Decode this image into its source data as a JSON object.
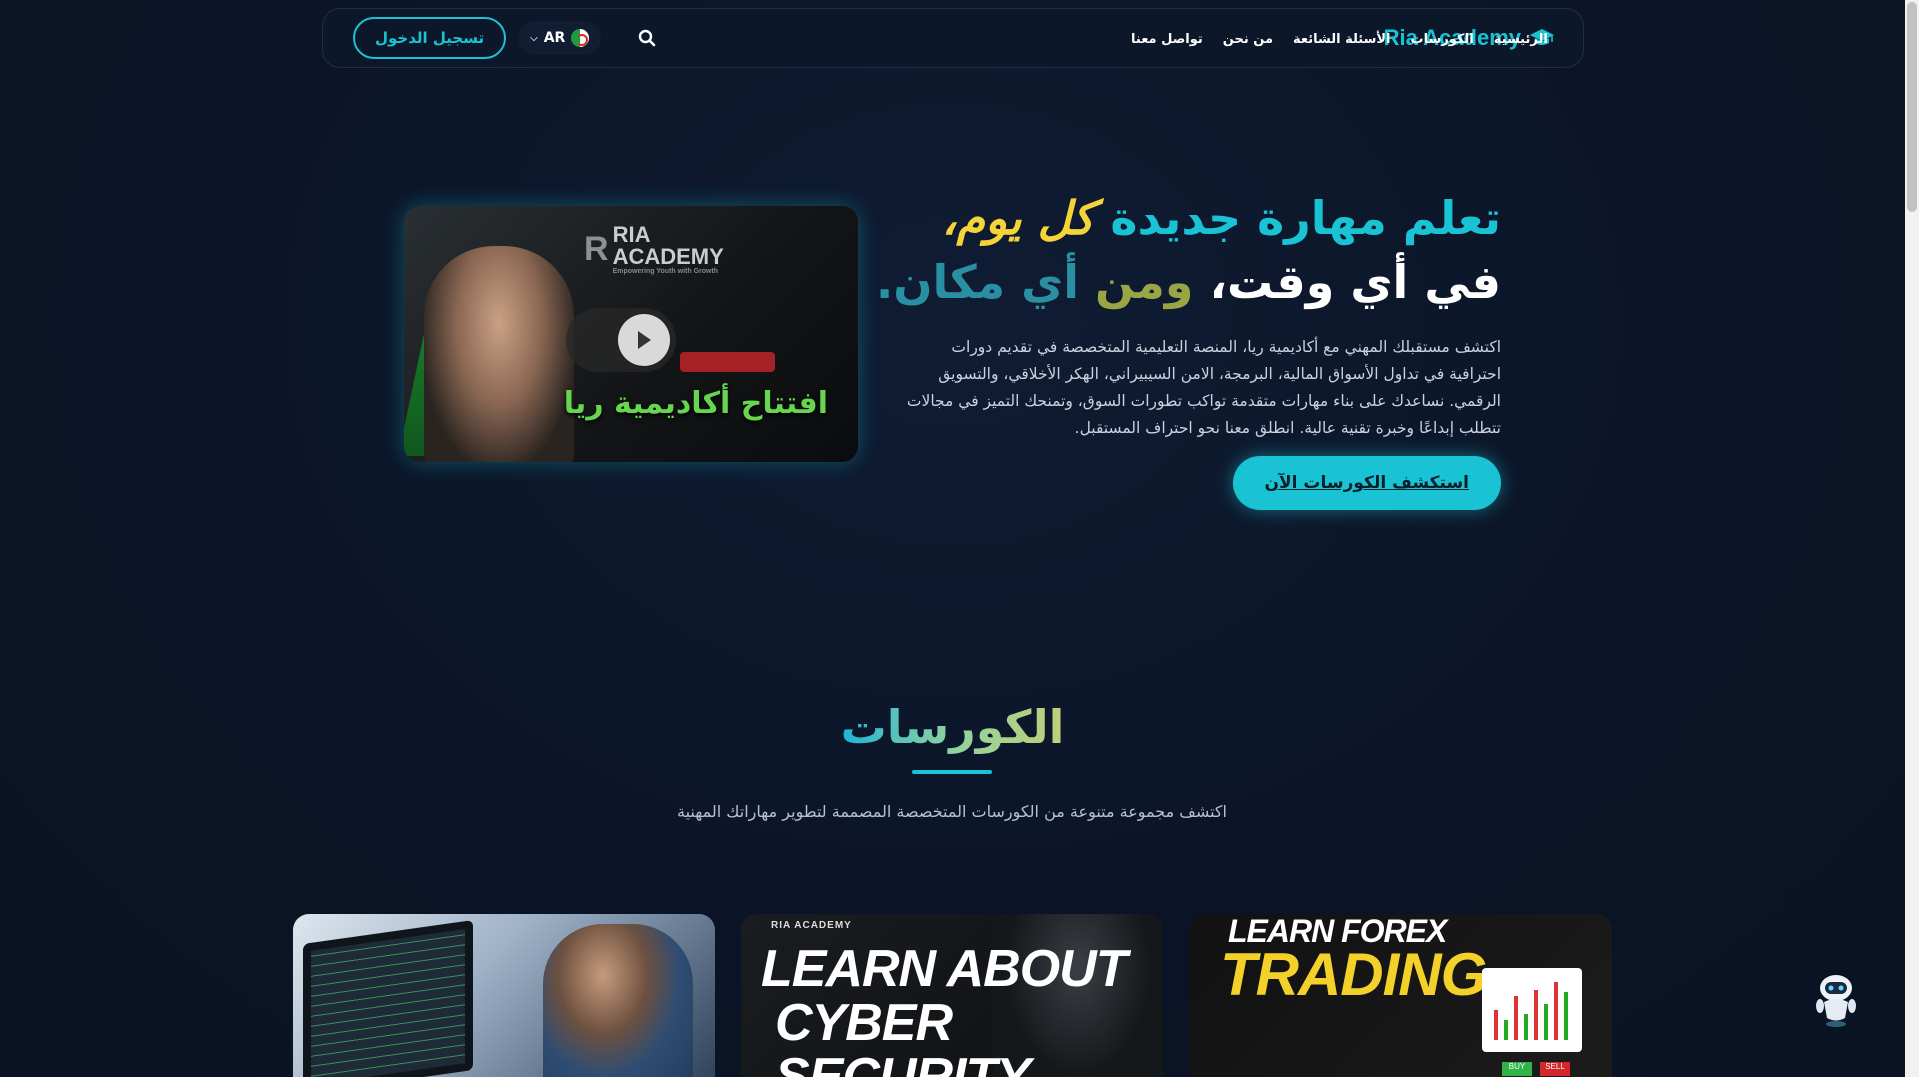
{
  "nav": {
    "login_label": "تسجيل الدخول",
    "lang_label": "AR",
    "links": [
      "الرئيسية",
      "الكورسات",
      "الأسئلة الشائعة",
      "من نحن",
      "تواصل معنا"
    ],
    "brand": "Ria Academy"
  },
  "hero": {
    "title_line1_a": "تعلم مهارة جديدة ",
    "title_line1_b": "كل يوم،",
    "title_line2_a": "في أي وقت، ",
    "title_line2_b": "ومن ",
    "title_line2_c": "أي مكان.",
    "description": "اكتشف مستقبلك المهني مع أكاديمية ريا، المنصة التعليمية المتخصصة في تقديم دورات احترافية في تداول الأسواق المالية، البرمجة، الامن السيبيراني، الهكر الأخلاقي، والتسويق الرقمي. نساعدك على بناء مهارات متقدمة تواكب تطورات السوق، وتمنحك التميز في مجالات تتطلب إبداعًا وخبرة تقنية عالية. انطلق معنا نحو احتراف المستقبل.",
    "cta_label": "استكشف الكورسات الآن",
    "video": {
      "logo_big": "R",
      "logo_line1": "RIA",
      "logo_line2": "ACADEMY",
      "logo_tagline": "Empowering Youth with Growth",
      "caption": "افتتاح أكاديمية ريا"
    }
  },
  "courses": {
    "title": "الكورسات",
    "subtitle": "اكتشف مجموعة متنوعة من الكورسات المتخصصة المصممة لتطوير مهاراتك المهنية",
    "cards": [
      {
        "name": "programming"
      },
      {
        "small": "RIA ACADEMY",
        "line1": "LEARN ABOUT",
        "line2": "CYBER SECURITY"
      },
      {
        "line1": "LEARN FOREX",
        "line2": "TRADING",
        "buy": "BUY",
        "sell": "SELL"
      }
    ]
  },
  "colors": {
    "accent": "#19c3d3",
    "background": "#0b1426",
    "highlight": "#f4d438"
  }
}
